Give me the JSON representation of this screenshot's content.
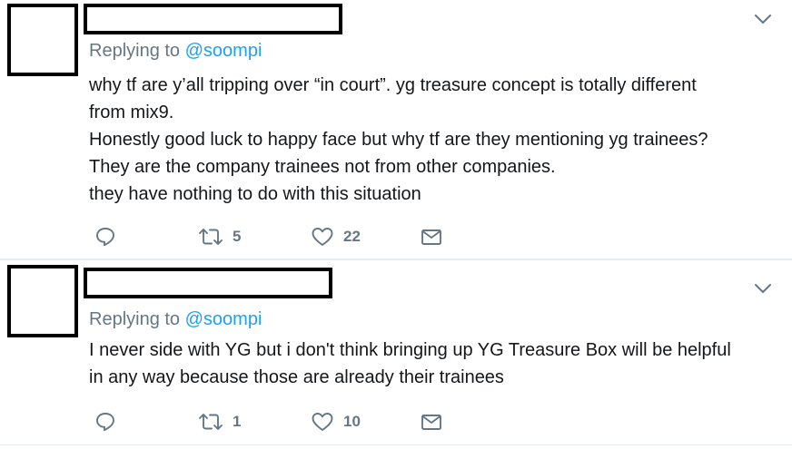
{
  "tweets": [
    {
      "replying_prefix": "Replying to ",
      "replying_handle": "@soompi",
      "lines": [
        "why tf are y’all tripping over “in court”. yg treasure concept is totally different",
        "from mix9.",
        "Honestly good luck to happy face but why tf are they mentioning yg trainees?",
        "They are the company trainees not from other companies.",
        "they have nothing to do with this situation"
      ],
      "retweets": "5",
      "likes": "22"
    },
    {
      "replying_prefix": "Replying to ",
      "replying_handle": "@soompi",
      "lines": [
        "I never side with YG but i don't think bringing up YG Treasure Box will be helpful",
        "in any way because those are already their trainees"
      ],
      "retweets": "1",
      "likes": "10"
    }
  ],
  "icons": {
    "reply": "reply-icon",
    "retweet": "retweet-icon",
    "like": "heart-icon",
    "dm": "envelope-icon",
    "more": "chevron-down-icon"
  },
  "colors": {
    "muted": "#657786",
    "link": "#1da1f2",
    "text": "#14171a",
    "divider": "#e6ecf0"
  }
}
